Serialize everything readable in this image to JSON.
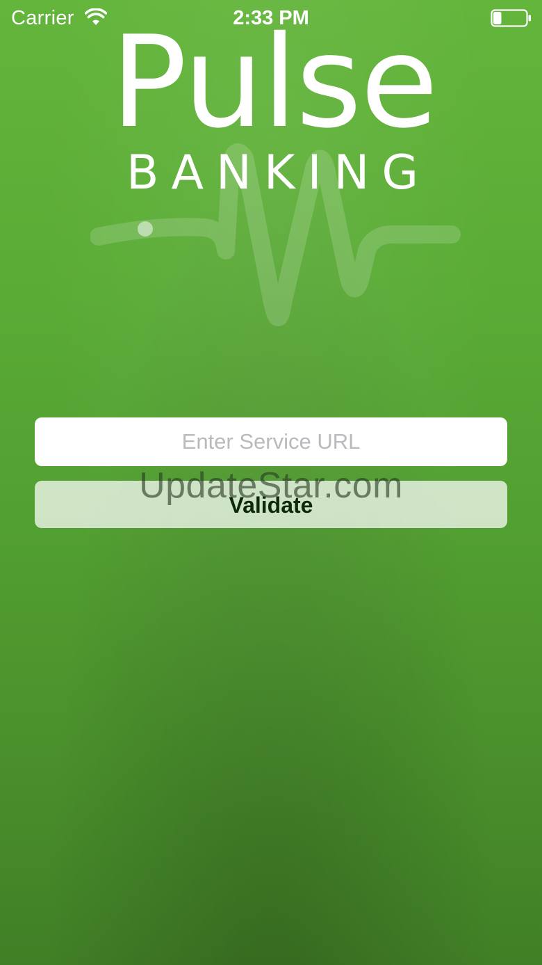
{
  "status_bar": {
    "carrier": "Carrier",
    "time": "2:33 PM",
    "wifi_icon": "wifi-icon",
    "battery_icon": "battery-icon",
    "battery_level": 0.25
  },
  "logo": {
    "title": "Pulse",
    "subtitle": "BANKING",
    "wave_icon": "pulse-wave-icon"
  },
  "form": {
    "url_placeholder": "Enter Service URL",
    "url_value": "",
    "validate_label": "Validate"
  },
  "watermark": "UpdateStar.com",
  "colors": {
    "background_top": "#63b53b",
    "background_bottom": "#417f26",
    "button_text": "#0c2a08",
    "input_background": "#ffffff"
  }
}
